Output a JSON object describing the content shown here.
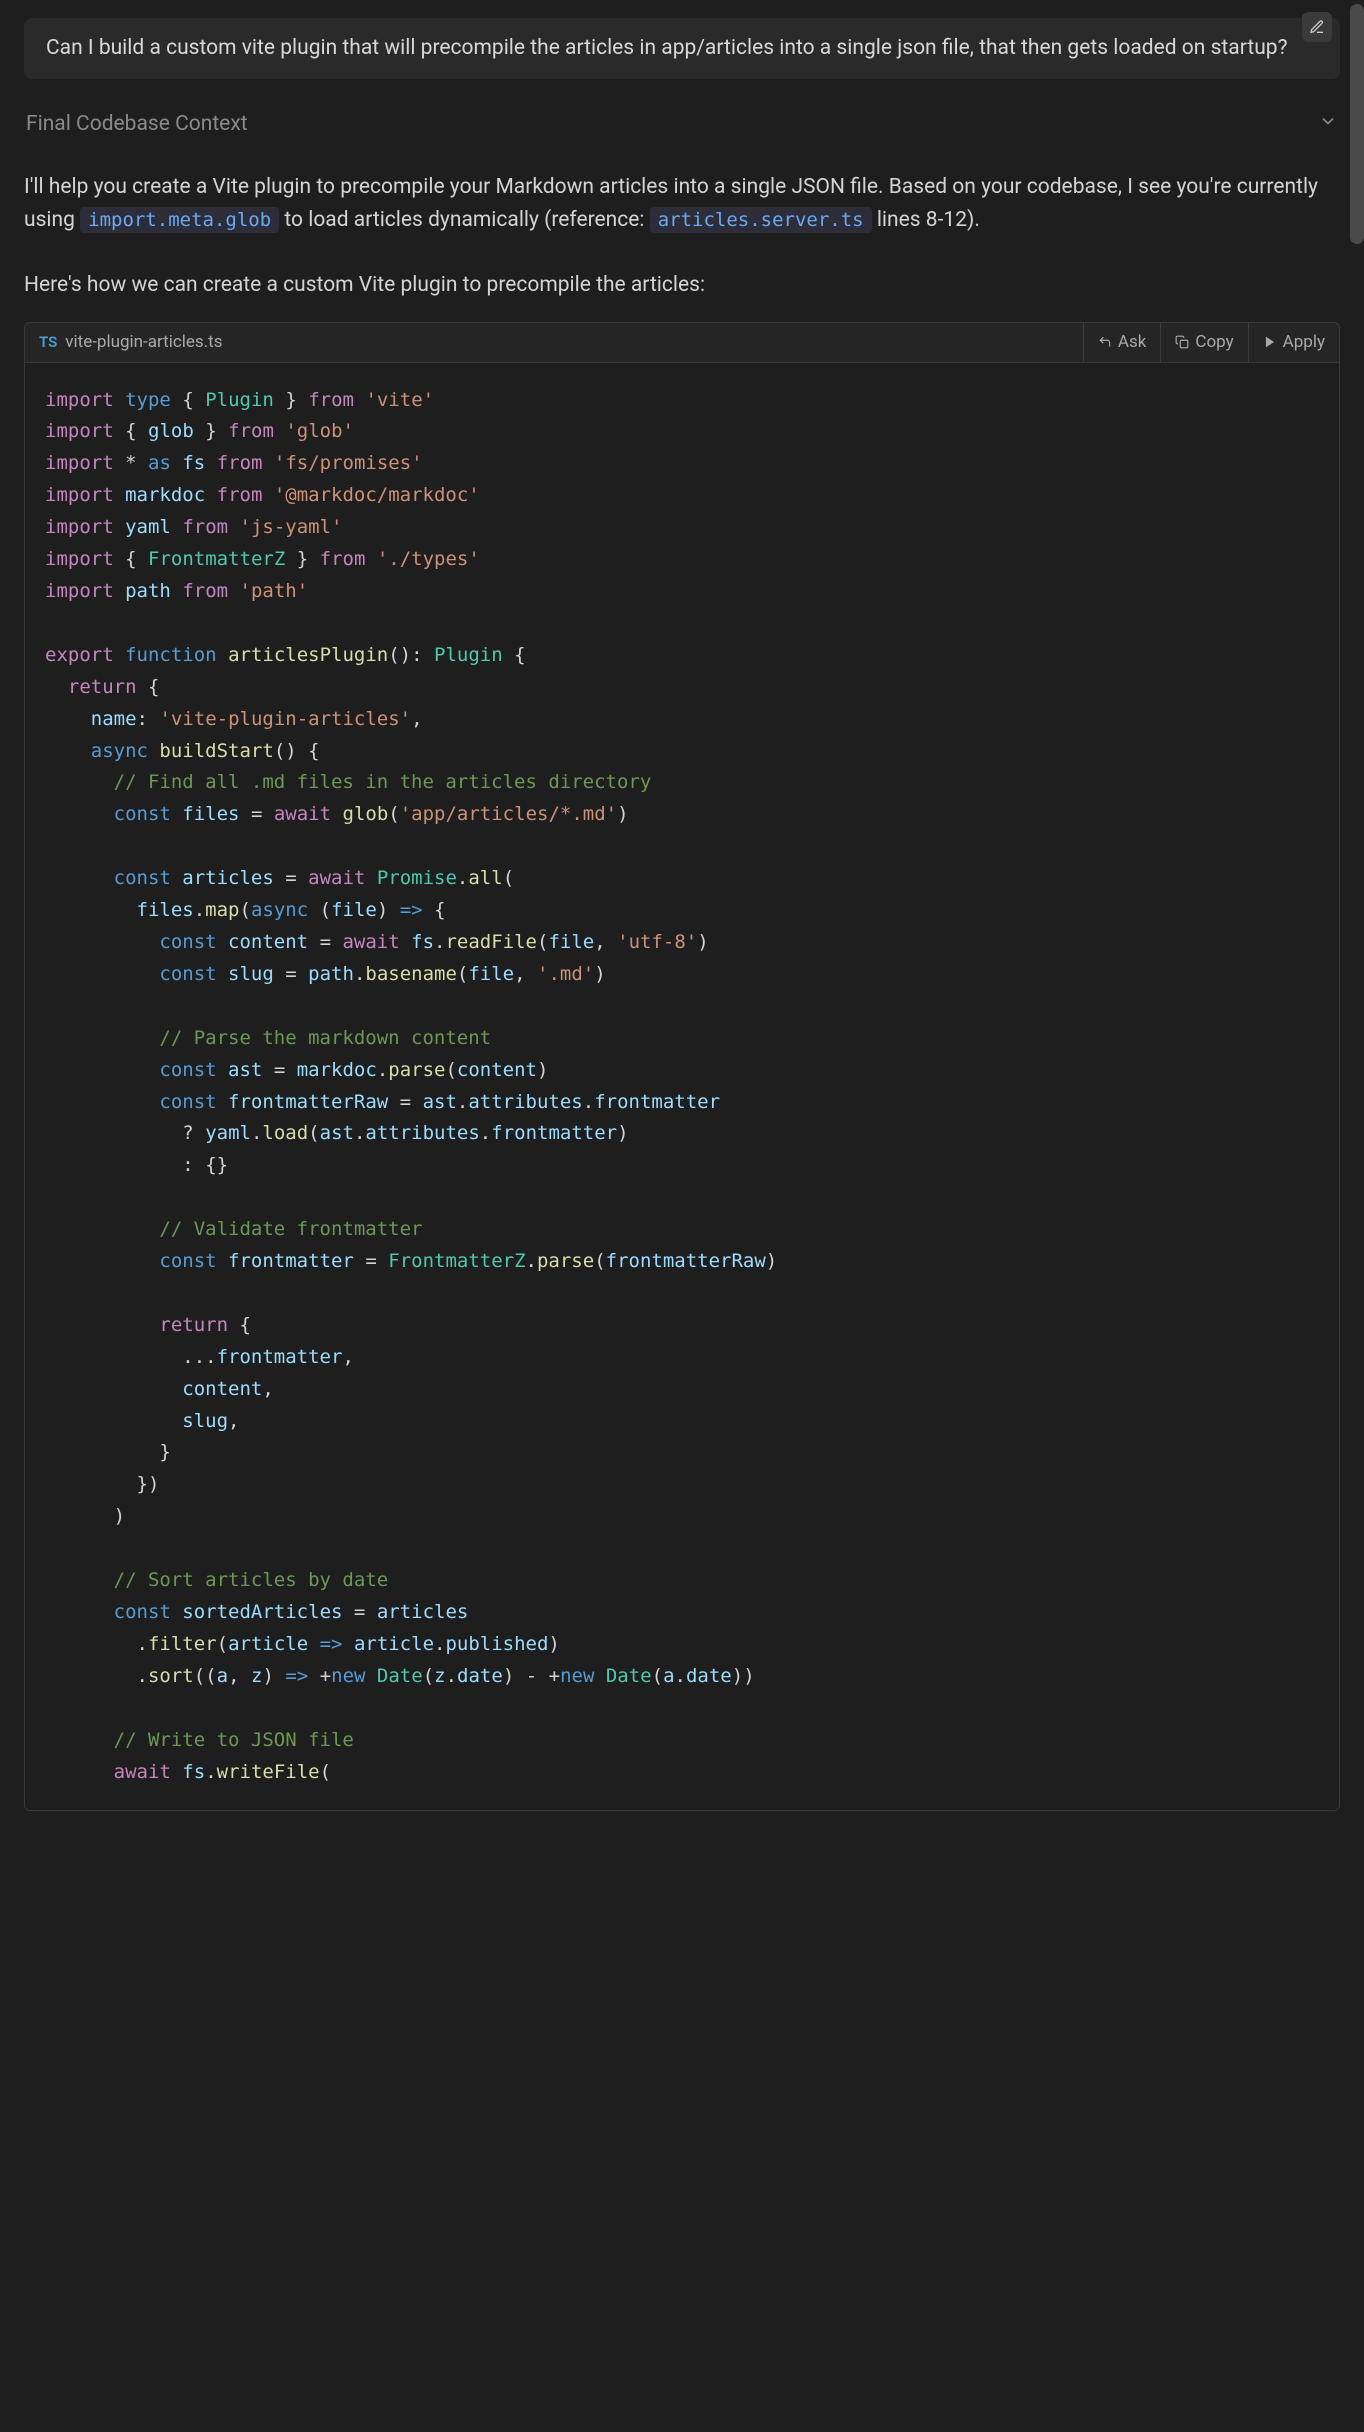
{
  "user_message": "Can I build a custom vite plugin that will precompile the articles in app/articles into a single json file, that then gets loaded on startup?",
  "context_label": "Final Codebase Context",
  "response": {
    "p1a": "I'll help you create a Vite plugin to precompile your Markdown articles into a single JSON file. Based on your codebase, I see you're currently using ",
    "p1_code1": "import.meta.glob",
    "p1b": " to load articles dynamically (reference: ",
    "p1_code2": "articles.server.ts",
    "p1c": " lines 8-12).",
    "p2": "Here's how we can create a custom Vite plugin to precompile the articles:"
  },
  "codecard": {
    "lang_badge": "TS",
    "filename": "vite-plugin-articles.ts",
    "btn_ask": "Ask",
    "btn_copy": "Copy",
    "btn_apply": "Apply"
  },
  "code": {
    "l1": {
      "a": "import",
      "b": "type",
      "c": "{",
      "d": "Plugin",
      "e": "}",
      "f": "from",
      "g": "'vite'"
    },
    "l2": {
      "a": "import",
      "b": "{",
      "c": "glob",
      "d": "}",
      "e": "from",
      "f": "'glob'"
    },
    "l3": {
      "a": "import",
      "b": "*",
      "c": "as",
      "d": "fs",
      "e": "from",
      "f": "'fs/promises'"
    },
    "l4": {
      "a": "import",
      "b": "markdoc",
      "c": "from",
      "d": "'@markdoc/markdoc'"
    },
    "l5": {
      "a": "import",
      "b": "yaml",
      "c": "from",
      "d": "'js-yaml'"
    },
    "l6": {
      "a": "import",
      "b": "{",
      "c": "FrontmatterZ",
      "d": "}",
      "e": "from",
      "f": "'./types'"
    },
    "l7": {
      "a": "import",
      "b": "path",
      "c": "from",
      "d": "'path'"
    },
    "l9": {
      "a": "export",
      "b": "function",
      "c": "articlesPlugin",
      "d": "():",
      "e": "Plugin",
      "f": "{"
    },
    "l10": {
      "a": "return",
      "b": "{"
    },
    "l11": {
      "a": "name",
      "b": ":",
      "c": "'vite-plugin-articles'",
      "d": ","
    },
    "l12": {
      "a": "async",
      "b": "buildStart",
      "c": "() {"
    },
    "l13": {
      "a": "// Find all .md files in the articles directory"
    },
    "l14": {
      "a": "const",
      "b": "files",
      "c": "=",
      "d": "await",
      "e": "glob",
      "f": "(",
      "g": "'app/articles/*.md'",
      "h": ")"
    },
    "l16": {
      "a": "const",
      "b": "articles",
      "c": "=",
      "d": "await",
      "e": "Promise",
      "f": ".",
      "g": "all",
      "h": "("
    },
    "l17": {
      "a": "files",
      "b": ".",
      "c": "map",
      "d": "(",
      "e": "async",
      "f": "(",
      "g": "file",
      "h": ")",
      "i": "=>",
      "j": "{"
    },
    "l18": {
      "a": "const",
      "b": "content",
      "c": "=",
      "d": "await",
      "e": "fs",
      "f": ".",
      "g": "readFile",
      "h": "(",
      "i": "file",
      "j": ",",
      "k": "'utf-8'",
      "l": ")"
    },
    "l19": {
      "a": "const",
      "b": "slug",
      "c": "=",
      "d": "path",
      "e": ".",
      "f": "basename",
      "g": "(",
      "h": "file",
      "i": ",",
      "j": "'.md'",
      "k": ")"
    },
    "l21": {
      "a": "// Parse the markdown content"
    },
    "l22": {
      "a": "const",
      "b": "ast",
      "c": "=",
      "d": "markdoc",
      "e": ".",
      "f": "parse",
      "g": "(",
      "h": "content",
      "i": ")"
    },
    "l23": {
      "a": "const",
      "b": "frontmatterRaw",
      "c": "=",
      "d": "ast",
      "e": ".",
      "f": "attributes",
      "g": ".",
      "h": "frontmatter"
    },
    "l24": {
      "a": "?",
      "b": "yaml",
      "c": ".",
      "d": "load",
      "e": "(",
      "f": "ast",
      "g": ".",
      "h": "attributes",
      "i": ".",
      "j": "frontmatter",
      "k": ")"
    },
    "l25": {
      "a": ":",
      "b": "{}"
    },
    "l27": {
      "a": "// Validate frontmatter"
    },
    "l28": {
      "a": "const",
      "b": "frontmatter",
      "c": "=",
      "d": "FrontmatterZ",
      "e": ".",
      "f": "parse",
      "g": "(",
      "h": "frontmatterRaw",
      "i": ")"
    },
    "l30": {
      "a": "return",
      "b": "{"
    },
    "l31": {
      "a": "...",
      "b": "frontmatter",
      "c": ","
    },
    "l32": {
      "a": "content",
      "b": ","
    },
    "l33": {
      "a": "slug",
      "b": ","
    },
    "l34": {
      "a": "}"
    },
    "l35": {
      "a": "})"
    },
    "l36": {
      "a": ")"
    },
    "l38": {
      "a": "// Sort articles by date"
    },
    "l39": {
      "a": "const",
      "b": "sortedArticles",
      "c": "=",
      "d": "articles"
    },
    "l40": {
      "a": ".",
      "b": "filter",
      "c": "(",
      "d": "article",
      "e": "=>",
      "f": "article",
      "g": ".",
      "h": "published",
      "i": ")"
    },
    "l41": {
      "a": ".",
      "b": "sort",
      "c": "((",
      "d": "a",
      "e": ",",
      "f": "z",
      "g": ")",
      "h": "=>",
      "i": "+",
      "j": "new",
      "k": "Date",
      "l": "(",
      "m": "z",
      "n": ".",
      "o": "date",
      "p": ")",
      "q": "-",
      "r": "+",
      "s": "new",
      "t": "Date",
      "u": "(",
      "v": "a",
      "w": ".",
      "x": "date",
      "y": "))"
    },
    "l43": {
      "a": "// Write to JSON file"
    },
    "l44": {
      "a": "await",
      "b": "fs",
      "c": ".",
      "d": "writeFile",
      "e": "("
    }
  }
}
